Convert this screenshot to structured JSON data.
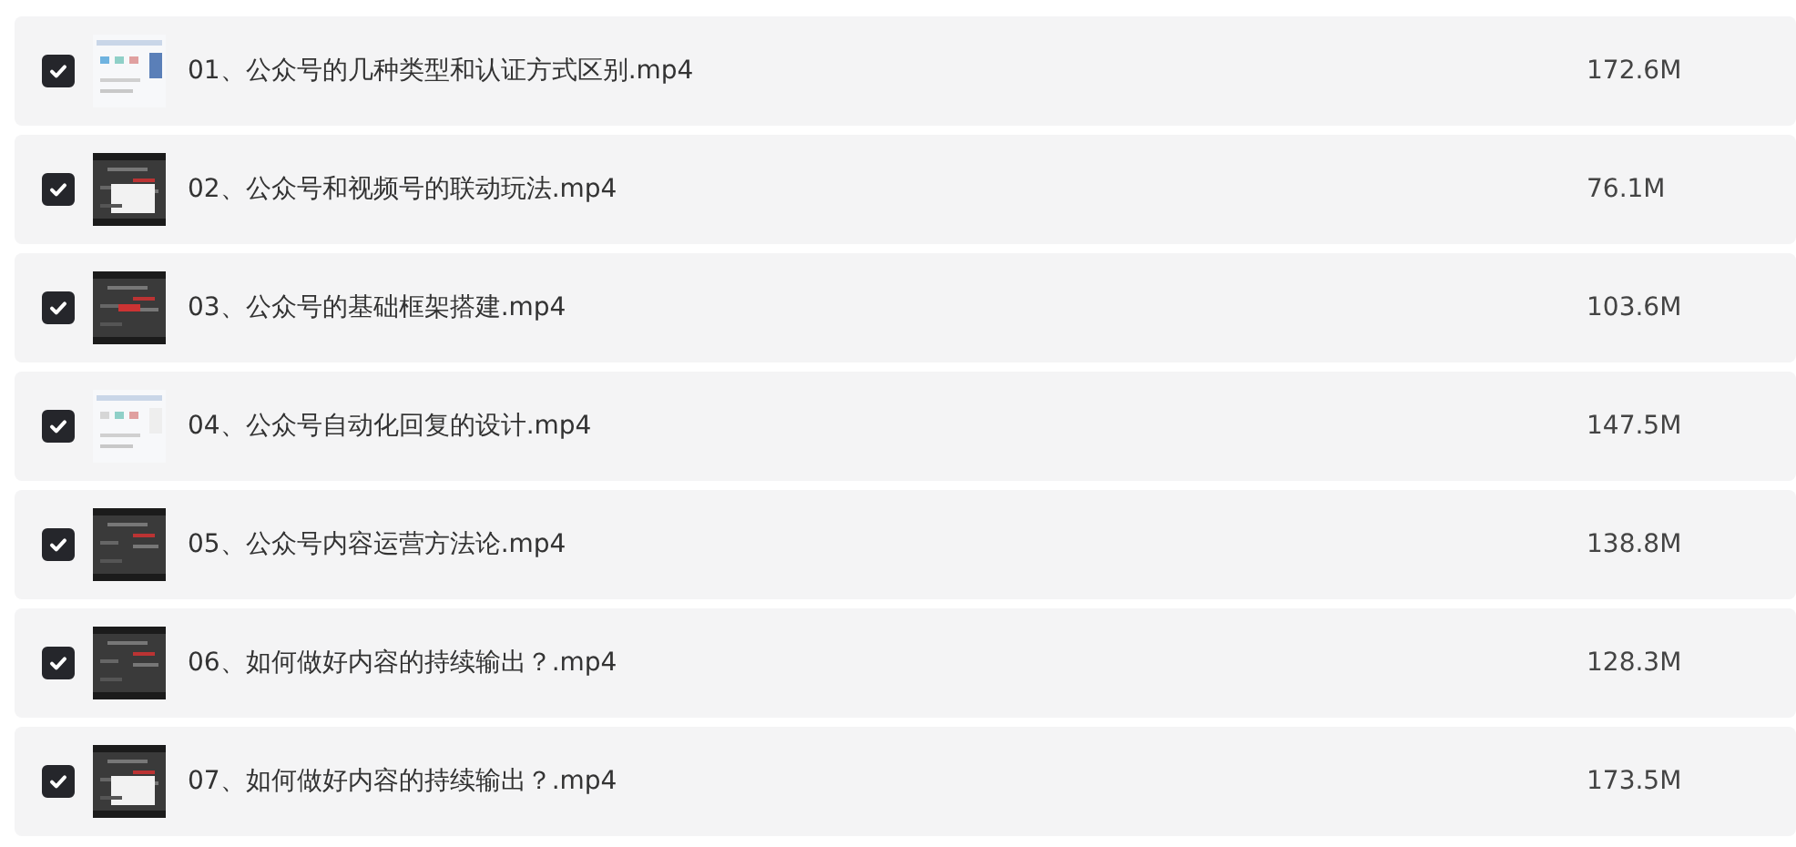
{
  "files": [
    {
      "name": "01、公众号的几种类型和认证方式区别.mp4",
      "size": "172.6M",
      "checked": true
    },
    {
      "name": "02、公众号和视频号的联动玩法.mp4",
      "size": "76.1M",
      "checked": true
    },
    {
      "name": "03、公众号的基础框架搭建.mp4",
      "size": "103.6M",
      "checked": true
    },
    {
      "name": "04、公众号自动化回复的设计.mp4",
      "size": "147.5M",
      "checked": true
    },
    {
      "name": "05、公众号内容运营方法论.mp4",
      "size": "138.8M",
      "checked": true
    },
    {
      "name": "06、如何做好内容的持续输出？.mp4",
      "size": "128.3M",
      "checked": true
    },
    {
      "name": "07、如何做好内容的持续输出？.mp4",
      "size": "173.5M",
      "checked": true
    }
  ]
}
